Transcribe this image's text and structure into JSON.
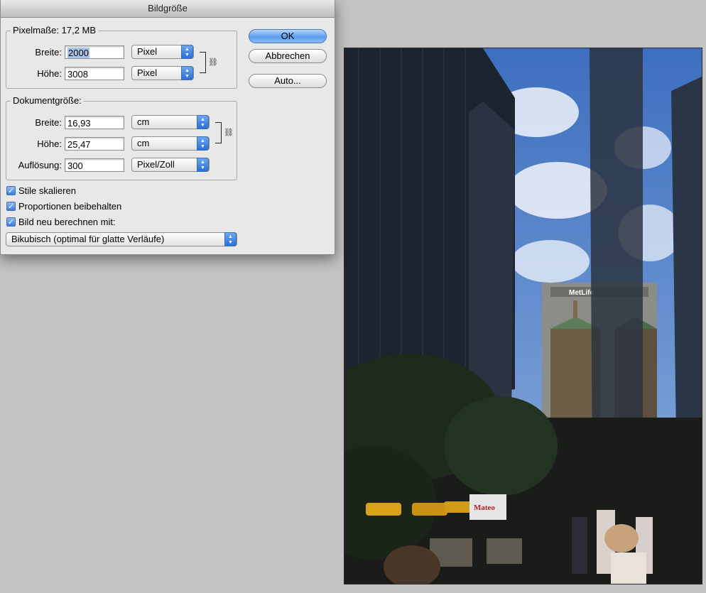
{
  "dialog": {
    "title": "Bildgröße",
    "pixel_section": {
      "legend": "Pixelmaße: 17,2 MB",
      "width_label": "Breite:",
      "width_value": "2000",
      "width_unit": "Pixel",
      "height_label": "Höhe:",
      "height_value": "3008",
      "height_unit": "Pixel"
    },
    "document_section": {
      "legend": "Dokumentgröße:",
      "width_label": "Breite:",
      "width_value": "16,93",
      "width_unit": "cm",
      "height_label": "Höhe:",
      "height_value": "25,47",
      "height_unit": "cm",
      "resolution_label": "Auflösung:",
      "resolution_value": "300",
      "resolution_unit": "Pixel/Zoll"
    },
    "buttons": {
      "ok": "OK",
      "cancel": "Abbrechen",
      "auto": "Auto..."
    },
    "options": {
      "scale_styles": {
        "label": "Stile skalieren",
        "checked": true
      },
      "constrain": {
        "label": "Proportionen beibehalten",
        "checked": true
      },
      "resample": {
        "label": "Bild neu berechnen mit:",
        "checked": true
      }
    },
    "resample_method": "Bikubisch (optimal für glatte Verläufe)"
  },
  "photo": {
    "sign_text": "MetLife",
    "truck_text": "Mateo"
  },
  "colors": {
    "accent": "#3a7ce0",
    "canvas_bg": "#c3c3c3",
    "dialog_bg": "#e8e8e8"
  }
}
